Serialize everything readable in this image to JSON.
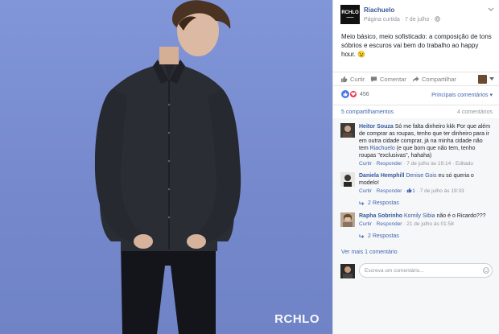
{
  "photo": {
    "watermark": "RCHLO",
    "colors": {
      "background": "#7b8fd0",
      "shirt": "#2b2d35",
      "pants": "#14151b"
    }
  },
  "post": {
    "page_name": "Riachuelo",
    "logo_text": "RCHLO",
    "meta": "Página curtida · 7 de julho · ",
    "text": "Meio básico, meio sofisticado: a composição de tons sóbrios e escuros vai bem do trabalho ao happy hour. 😉",
    "actions": {
      "like": "Curtir",
      "comment": "Comentar",
      "share": "Compartilhar"
    },
    "reaction_count": "456",
    "top_comments_label": "Principais comentários ▾",
    "shares": "5 compartilhamentos",
    "comments_count": "4 comentários"
  },
  "comments": [
    {
      "author": "Heitor Souza",
      "text_before": " Só me falta dinheiro kkk Por que além de comprar as roupas, tenho que ter dinheiro para ir em outra cidade comprar, já na minha cidade não tem ",
      "mention": "Riachuelo",
      "text_after": " (e que bom que não tem, tenho roupas \"exclusivas\", hahaha)",
      "like": "Curtir",
      "reply": "Responder",
      "time": "7 de julho às 19:14",
      "edited": "Editado"
    },
    {
      "author": "Daniela Hemphill",
      "mention": "Denise Gois",
      "text_after": " eu só queria o modelo!",
      "like": "Curtir",
      "reply": "Responder",
      "likes": "1",
      "time": "7 de julho às 19:33",
      "replies": "2 Respostas"
    },
    {
      "author": "Rapha Sobrinho",
      "mention": "Komily Sibia",
      "text_after": " não é o Ricardo???",
      "like": "Curtir",
      "reply": "Responder",
      "time": "21 de julho às 01:58",
      "replies": "2 Respostas"
    }
  ],
  "more_comments": "Ver mais 1 comentário",
  "composer": {
    "placeholder": "Escreva um comentário..."
  }
}
